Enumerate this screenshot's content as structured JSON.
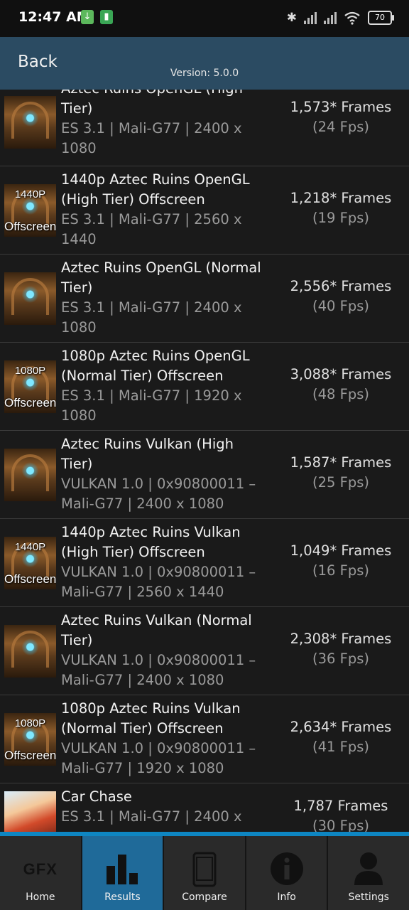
{
  "status_bar": {
    "time": "12:47 AM",
    "battery": "70"
  },
  "header": {
    "back_label": "Back",
    "version": "Version: 5.0.0"
  },
  "results": [
    {
      "title": "Aztec Ruins OpenGL (High Tier)",
      "sub": "ES 3.1 | Mali-G77 | 2400 x 1080",
      "frames": "1,573* Frames",
      "fps": "(24 Fps)",
      "tag_top": "",
      "tag_bottom": ""
    },
    {
      "title": "1440p Aztec Ruins OpenGL (High Tier) Offscreen",
      "sub": "ES 3.1 | Mali-G77 | 2560 x 1440",
      "frames": "1,218* Frames",
      "fps": "(19 Fps)",
      "tag_top": "1440P",
      "tag_bottom": "Offscreen"
    },
    {
      "title": "Aztec Ruins OpenGL (Normal Tier)",
      "sub": "ES 3.1 | Mali-G77 | 2400 x 1080",
      "frames": "2,556* Frames",
      "fps": "(40 Fps)",
      "tag_top": "",
      "tag_bottom": ""
    },
    {
      "title": "1080p Aztec Ruins OpenGL (Normal Tier) Offscreen",
      "sub": "ES 3.1 | Mali-G77 | 1920 x 1080",
      "frames": "3,088* Frames",
      "fps": "(48 Fps)",
      "tag_top": "1080P",
      "tag_bottom": "Offscreen"
    },
    {
      "title": "Aztec Ruins Vulkan (High Tier)",
      "sub": "VULKAN 1.0 | 0x90800011 – Mali-G77 | 2400 x 1080",
      "frames": "1,587* Frames",
      "fps": "(25 Fps)",
      "tag_top": "",
      "tag_bottom": ""
    },
    {
      "title": "1440p Aztec Ruins Vulkan (High Tier) Offscreen",
      "sub": "VULKAN 1.0 | 0x90800011 – Mali-G77 | 2560 x 1440",
      "frames": "1,049* Frames",
      "fps": "(16 Fps)",
      "tag_top": "1440P",
      "tag_bottom": "Offscreen"
    },
    {
      "title": "Aztec Ruins Vulkan (Normal Tier)",
      "sub": "VULKAN 1.0 | 0x90800011 – Mali-G77 | 2400 x 1080",
      "frames": "2,308* Frames",
      "fps": "(36 Fps)",
      "tag_top": "",
      "tag_bottom": ""
    },
    {
      "title": "1080p Aztec Ruins Vulkan (Normal Tier) Offscreen",
      "sub": "VULKAN 1.0 | 0x90800011 – Mali-G77 | 1920 x 1080",
      "frames": "2,634* Frames",
      "fps": "(41 Fps)",
      "tag_top": "1080P",
      "tag_bottom": "Offscreen"
    },
    {
      "title": "Car Chase",
      "sub": "ES 3.1 | Mali-G77 | 2400 x",
      "frames": "1,787 Frames",
      "fps": "(30 Fps)",
      "tag_top": "",
      "tag_bottom": ""
    }
  ],
  "nav": {
    "home": "Home",
    "results": "Results",
    "compare": "Compare",
    "info": "Info",
    "settings": "Settings",
    "home_icon_text": "GFX"
  },
  "colors": {
    "header_bg": "#2b4b62",
    "accent": "#0e86c2",
    "active_tab": "#1f6a99"
  }
}
